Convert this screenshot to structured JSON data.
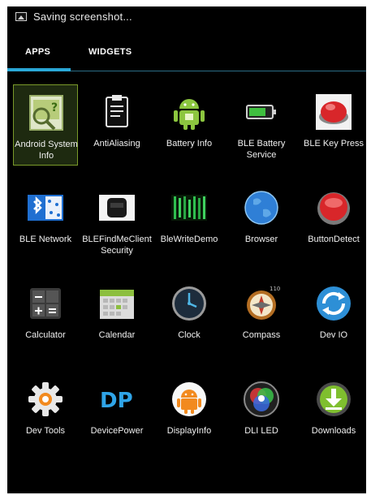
{
  "status": {
    "text": "Saving screenshot..."
  },
  "tabs": [
    {
      "label": "APPS"
    },
    {
      "label": "WIDGETS"
    }
  ],
  "apps": [
    {
      "label": "Android System Info",
      "icon": "android-system-info-icon"
    },
    {
      "label": "AntiAliasing",
      "icon": "clipboard-icon"
    },
    {
      "label": "Battery Info",
      "icon": "android-battery-icon"
    },
    {
      "label": "BLE Battery Service",
      "icon": "battery-icon"
    },
    {
      "label": "BLE Key Press",
      "icon": "red-button-icon"
    },
    {
      "label": "BLE Network",
      "icon": "bluetooth-network-icon"
    },
    {
      "label": "BLEFindMeClient Security",
      "icon": "key-fob-icon"
    },
    {
      "label": "BleWriteDemo",
      "icon": "matrix-icon"
    },
    {
      "label": "Browser",
      "icon": "globe-icon"
    },
    {
      "label": "ButtonDetect",
      "icon": "red-round-button-icon"
    },
    {
      "label": "Calculator",
      "icon": "calculator-icon"
    },
    {
      "label": "Calendar",
      "icon": "calendar-icon"
    },
    {
      "label": "Clock",
      "icon": "clock-icon"
    },
    {
      "label": "Compass",
      "icon": "compass-icon"
    },
    {
      "label": "Dev IO",
      "icon": "sync-icon"
    },
    {
      "label": "Dev Tools",
      "icon": "gear-icon"
    },
    {
      "label": "DevicePower",
      "icon": "dp-icon"
    },
    {
      "label": "DisplayInfo",
      "icon": "orange-android-icon"
    },
    {
      "label": "DLI LED",
      "icon": "rgb-led-icon"
    },
    {
      "label": "Downloads",
      "icon": "download-icon"
    }
  ],
  "compass_badge": "110"
}
